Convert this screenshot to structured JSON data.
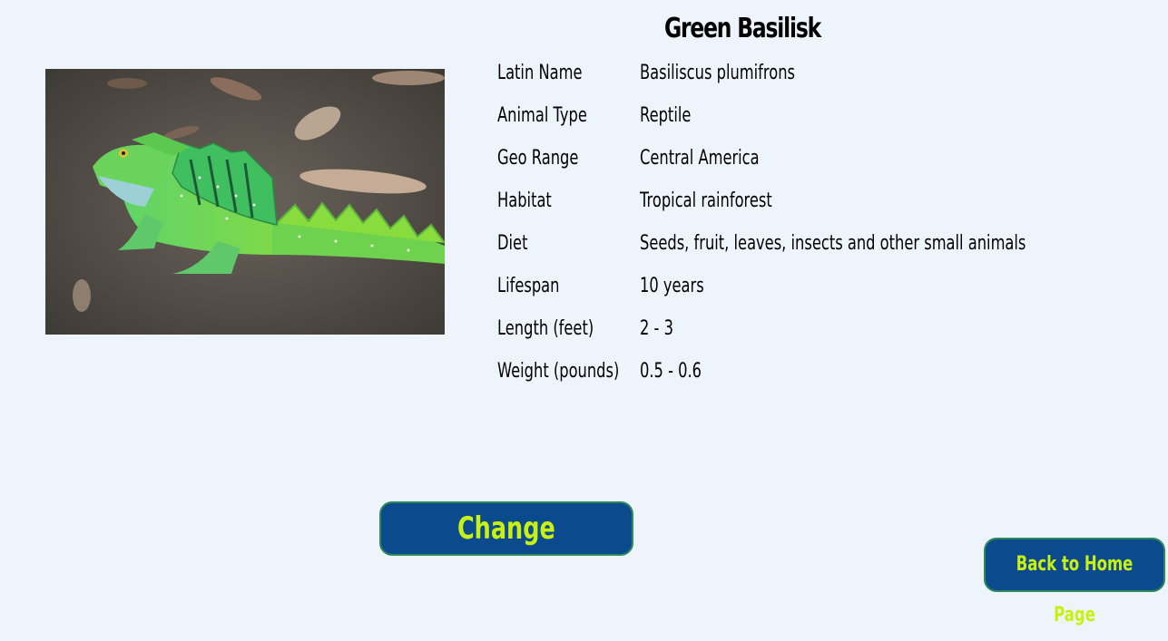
{
  "animal": {
    "name": "Green Basilisk",
    "image_alt": "Green basilisk lizard on soil"
  },
  "details": [
    {
      "label": "Latin Name",
      "value": "Basiliscus plumifrons"
    },
    {
      "label": "Animal Type",
      "value": "Reptile"
    },
    {
      "label": "Geo Range",
      "value": "Central America"
    },
    {
      "label": "Habitat",
      "value": "Tropical rainforest"
    },
    {
      "label": "Diet",
      "value": "Seeds, fruit, leaves, insects and other small animals"
    },
    {
      "label": "Lifespan",
      "value": "10 years"
    },
    {
      "label": "Length (feet)",
      "value": "2 - 3"
    },
    {
      "label": "Weight (pounds)",
      "value": "0.5 - 0.6"
    }
  ],
  "buttons": {
    "change_label": "Change",
    "home_label": "Back to Home Page"
  },
  "colors": {
    "background": "#eef4fc",
    "button_bg": "#0b4a8c",
    "button_text": "#c9f013",
    "button_border": "#2f8a5b"
  }
}
